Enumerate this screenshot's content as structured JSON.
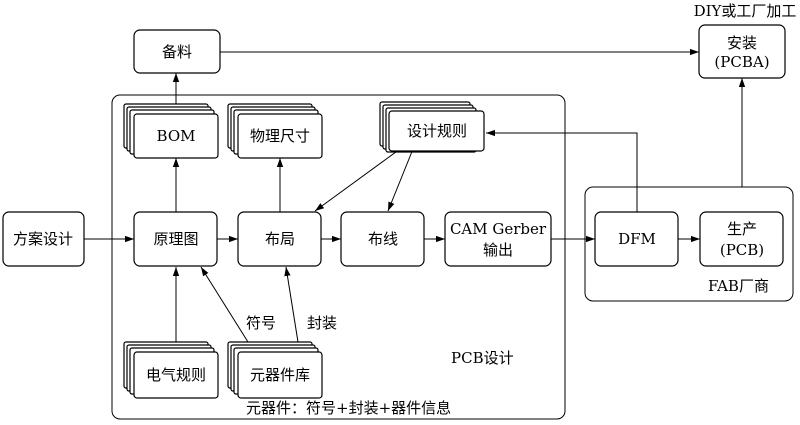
{
  "top_label": "DIY或工厂加工",
  "boxes": {
    "beiliao": "备料",
    "anzhuang_line1": "安装",
    "anzhuang_line2": "(PCBA)",
    "bom": "BOM",
    "wuli": "物理尺寸",
    "sheji_guize": "设计规则",
    "fangan": "方案设计",
    "yuanlitu": "原理图",
    "buju": "布局",
    "buxian": "布线",
    "cam_line1": "CAM Gerber",
    "cam_line2": "输出",
    "dfm": "DFM",
    "shengchan_line1": "生产",
    "shengchan_line2": "(PCB)",
    "dianqi_guize": "电气规则",
    "yuanqijian_ku": "元器件库"
  },
  "labels": {
    "fuhao": "符号",
    "fengzhuang": "封装",
    "pcb_group": "PCB设计",
    "fab_group": "FAB厂商",
    "component_note": "元器件：符号+封装+器件信息"
  }
}
